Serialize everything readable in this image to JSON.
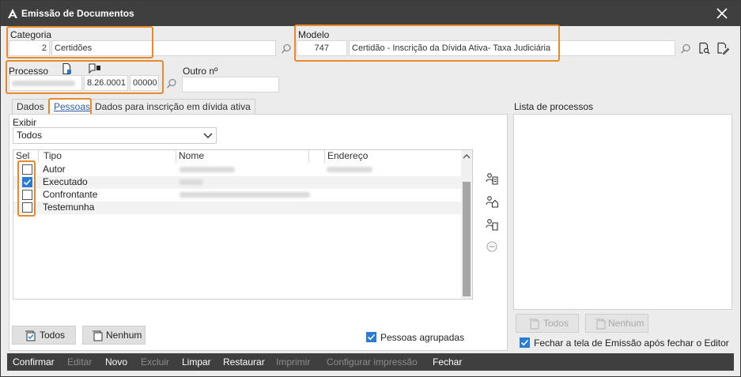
{
  "window": {
    "title": "Emissão de Documentos"
  },
  "categoria": {
    "label": "Categoria",
    "code": "2",
    "name": "Certidões"
  },
  "modelo": {
    "label": "Modelo",
    "code": "747",
    "name": "Certidão - Inscrição da Dívida Ativa- Taxa Judiciária"
  },
  "processo": {
    "label": "Processo",
    "part2": "8.26.0001",
    "part3": "00000"
  },
  "outro": {
    "label": "Outro nº",
    "value": ""
  },
  "tabs": [
    {
      "label": "Dados"
    },
    {
      "label": "Pessoas"
    },
    {
      "label": "Dados para inscrição em dívida ativa"
    }
  ],
  "exibir": {
    "label": "Exibir",
    "value": "Todos"
  },
  "grid": {
    "headers": {
      "sel": "Sel",
      "tipo": "Tipo",
      "nome": "Nome",
      "endereco": "Endereço"
    },
    "rows": [
      {
        "tipo": "Autor",
        "checked": false
      },
      {
        "tipo": "Executado",
        "checked": true
      },
      {
        "tipo": "Confrontante",
        "checked": false
      },
      {
        "tipo": "Testemunha",
        "checked": false
      }
    ]
  },
  "buttons": {
    "todos": "Todos",
    "nenhum": "Nenhum"
  },
  "pessoas_agrupadas": {
    "label": "Pessoas agrupadas",
    "checked": true
  },
  "lista": {
    "label": "Lista de processos",
    "todos": "Todos",
    "nenhum": "Nenhum"
  },
  "fechar_tela": {
    "label": "Fechar a tela de Emissão após fechar o Editor",
    "checked": true
  },
  "bottom": {
    "confirmar": "Confirmar",
    "editar": "Editar",
    "novo": "Novo",
    "excluir": "Excluir",
    "limpar": "Limpar",
    "restaurar": "Restaurar",
    "imprimir": "Imprimir",
    "configurar": "Configurar impressão",
    "fechar": "Fechar"
  },
  "colors": {
    "highlight": "#e8892b",
    "accent": "#2a7bd6",
    "titlebar": "#3f3f3f"
  }
}
